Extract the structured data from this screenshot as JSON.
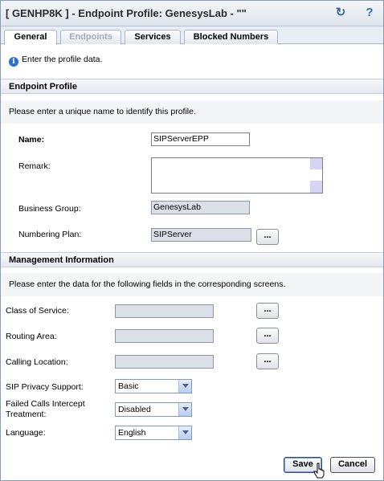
{
  "window": {
    "title": "[ GENHP8K ] - Endpoint Profile: GenesysLab - \"\"",
    "refresh_icon": "refresh-icon",
    "help_icon": "help-icon"
  },
  "tabs": [
    {
      "label": "General",
      "state": "active"
    },
    {
      "label": "Endpoints",
      "state": "disabled"
    },
    {
      "label": "Services",
      "state": "normal"
    },
    {
      "label": "Blocked Numbers",
      "state": "normal"
    }
  ],
  "info": {
    "text": "Enter the profile data."
  },
  "endpoint_profile": {
    "header": "Endpoint Profile",
    "description": "Please enter a unique name to identify this profile.",
    "name_label": "Name:",
    "name_value": "SIPServerEPP",
    "remark_label": "Remark:",
    "remark_value": "",
    "business_group_label": "Business Group:",
    "business_group_value": "GenesysLab",
    "numbering_plan_label": "Numbering Plan:",
    "numbering_plan_value": "SIPServer",
    "browse_label": "..."
  },
  "management": {
    "header": "Management Information",
    "description": "Please enter the data for the following fields in the corresponding screens.",
    "class_of_service_label": "Class of Service:",
    "class_of_service_value": "",
    "routing_area_label": "Routing Area:",
    "routing_area_value": "",
    "calling_location_label": "Calling Location:",
    "calling_location_value": "",
    "sip_privacy_label": "SIP Privacy Support:",
    "sip_privacy_value": "Basic",
    "failed_calls_label_1": "Failed Calls Intercept",
    "failed_calls_label_2": "Treatment:",
    "failed_calls_value": "Disabled",
    "language_label": "Language:",
    "language_value": "English",
    "browse_label": "..."
  },
  "footer": {
    "save_label": "Save",
    "cancel_label": "Cancel"
  }
}
